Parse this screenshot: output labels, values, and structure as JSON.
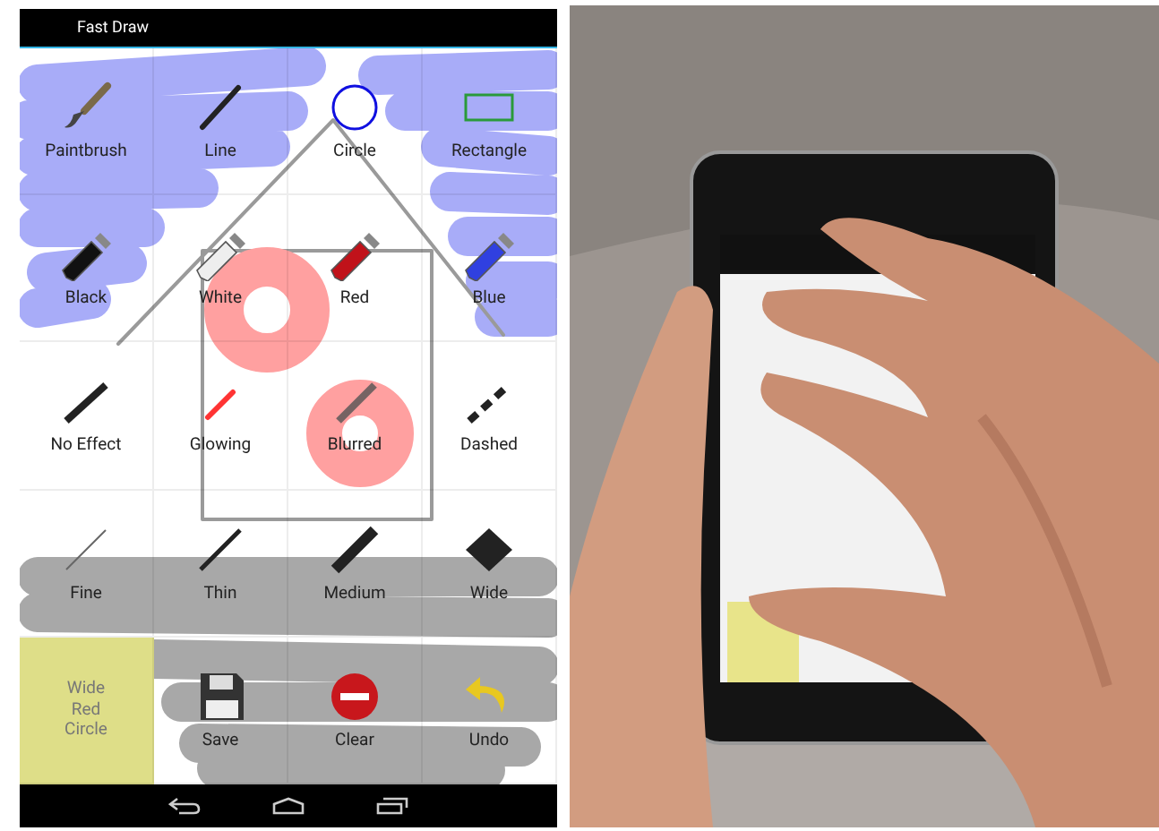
{
  "window": {
    "title": "Fast Draw"
  },
  "cells": [
    {
      "kind": "paintbrush",
      "label": "Paintbrush"
    },
    {
      "kind": "line",
      "label": "Line"
    },
    {
      "kind": "circle",
      "label": "Circle"
    },
    {
      "kind": "rectangle",
      "label": "Rectangle"
    },
    {
      "kind": "tube",
      "label": "Black",
      "color": "#111111"
    },
    {
      "kind": "tube",
      "label": "White",
      "color": "#eeeeee"
    },
    {
      "kind": "tube",
      "label": "Red",
      "color": "#c0121a"
    },
    {
      "kind": "tube",
      "label": "Blue",
      "color": "#3040e0"
    },
    {
      "kind": "plain",
      "label": "No Effect"
    },
    {
      "kind": "glow",
      "label": "Glowing"
    },
    {
      "kind": "blur",
      "label": "Blurred"
    },
    {
      "kind": "dashed",
      "label": "Dashed"
    },
    {
      "kind": "fine",
      "label": "Fine"
    },
    {
      "kind": "thin",
      "label": "Thin"
    },
    {
      "kind": "medium",
      "label": "Medium"
    },
    {
      "kind": "wide",
      "label": "Wide"
    },
    {
      "kind": "status",
      "label": "Wide Red Circle"
    },
    {
      "kind": "save",
      "label": "Save"
    },
    {
      "kind": "clear",
      "label": "Clear"
    },
    {
      "kind": "undo",
      "label": "Undo"
    }
  ]
}
